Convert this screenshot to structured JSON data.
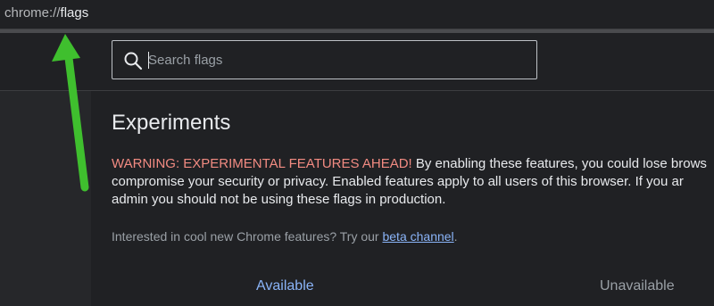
{
  "address_bar": {
    "url_scheme": "chrome://",
    "url_host": "flags"
  },
  "search": {
    "placeholder": "Search flags",
    "icon": "search-icon"
  },
  "main": {
    "title": "Experiments",
    "warning_label": "WARNING: EXPERIMENTAL FEATURES AHEAD!",
    "warning_line1": " By enabling these features, you could lose brows",
    "warning_line2": "compromise your security or privacy. Enabled features apply to all users of this browser. If you ar",
    "warning_line3": "admin you should not be using these flags in production.",
    "interest_prefix": "Interested in cool new Chrome features? Try our ",
    "beta_link": "beta channel",
    "interest_suffix": "."
  },
  "tabs": [
    {
      "label": "Available",
      "selected": true
    },
    {
      "label": "Unavailable",
      "selected": false
    }
  ],
  "colors": {
    "background": "#202124",
    "warning": "#f28b82",
    "link": "#8ab4f8",
    "annotation_arrow": "#3fbf2e"
  }
}
